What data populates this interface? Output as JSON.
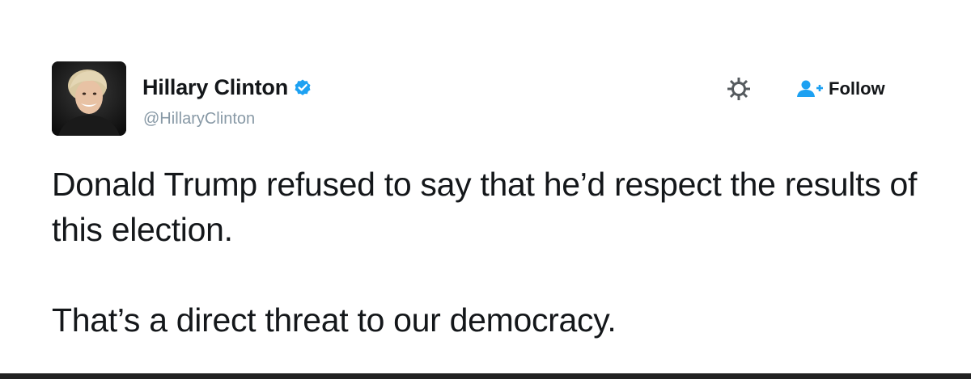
{
  "author": {
    "display_name": "Hillary Clinton",
    "handle": "@HillaryClinton",
    "verified": true,
    "avatar_icon": "profile-photo"
  },
  "actions": {
    "settings_icon": "gear-icon",
    "follow_icon": "add-user-icon",
    "follow_label": "Follow"
  },
  "tweet": {
    "paragraphs": [
      "Donald Trump refused to say that he’d respect the results of this election.",
      "That’s a direct threat to our democracy."
    ]
  },
  "colors": {
    "text": "#14171a",
    "handle": "#8899a6",
    "verified": "#1da1f2",
    "follow_icon": "#1da1f2"
  }
}
